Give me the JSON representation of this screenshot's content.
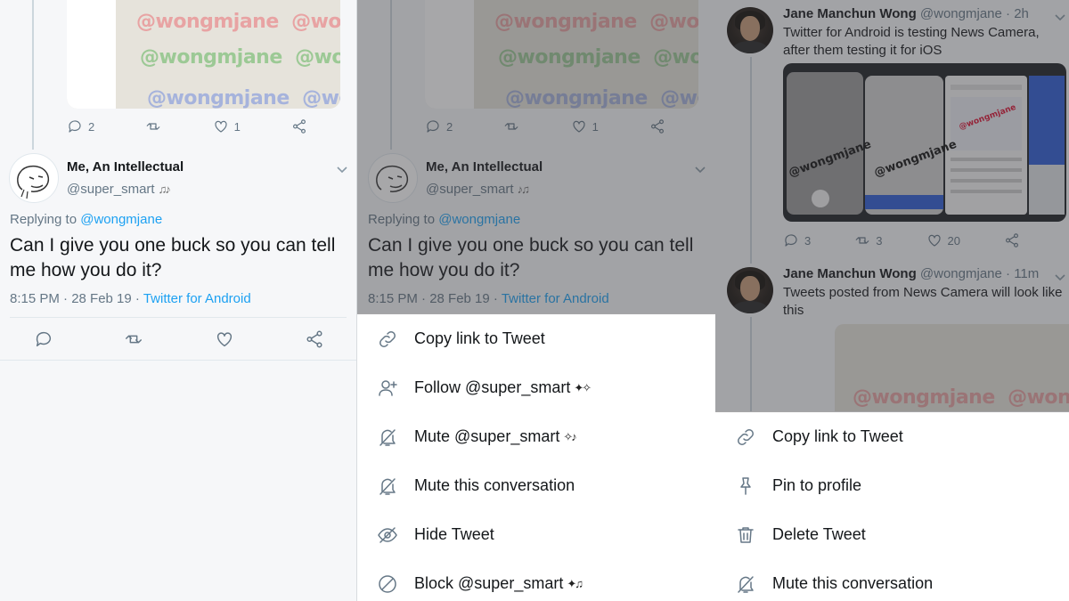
{
  "panel1": {
    "watermark": "@wongmjane",
    "parent_actions": {
      "reply_count": "2",
      "like_count": "1"
    },
    "reply": {
      "author_name": "Me, An Intellectual",
      "author_handle": "@super_smart",
      "replying_prefix": "Replying to",
      "replying_to": "@wongmjane",
      "text": "Can I give you one buck so you can tell me how you do it?",
      "timestamp": "8:15 PM · 28 Feb 19 ·",
      "source": "Twitter for Android"
    }
  },
  "panel2": {
    "watermark": "@wongmjane",
    "parent_actions": {
      "reply_count": "2",
      "like_count": "1"
    },
    "reply": {
      "author_name": "Me, An Intellectual",
      "author_handle": "@super_smart",
      "replying_prefix": "Replying to",
      "replying_to": "@wongmjane",
      "text": "Can I give you one buck so you can tell me how you do it?",
      "timestamp": "8:15 PM · 28 Feb 19 ·",
      "source": "Twitter for Android"
    },
    "menu": [
      {
        "label": "Copy link to Tweet",
        "icon": "link-icon"
      },
      {
        "label": "Follow @super_smart",
        "icon": "follow-icon"
      },
      {
        "label": "Mute @super_smart",
        "icon": "mute-icon"
      },
      {
        "label": "Mute this conversation",
        "icon": "mute-icon"
      },
      {
        "label": "Hide Tweet",
        "icon": "hide-icon"
      },
      {
        "label": "Block @super_smart",
        "icon": "block-icon"
      }
    ]
  },
  "panel3": {
    "tweet1": {
      "author_name": "Jane Manchun Wong",
      "author_handle": "@wongmjane",
      "time": "· 2h",
      "text": "Twitter for Android is testing News Camera, after them testing it for iOS",
      "reply_count": "3",
      "retweet_count": "3",
      "like_count": "20",
      "image_watermark": "@wongmjane"
    },
    "tweet2": {
      "author_name": "Jane Manchun Wong",
      "author_handle": "@wongmjane",
      "time": "· 11m",
      "text": "Tweets posted from News Camera will look like this",
      "image_watermark": "@wongmjane"
    },
    "menu": [
      {
        "label": "Copy link to Tweet",
        "icon": "link-icon"
      },
      {
        "label": "Pin to profile",
        "icon": "pin-icon"
      },
      {
        "label": "Delete Tweet",
        "icon": "trash-icon"
      },
      {
        "label": "Mute this conversation",
        "icon": "mute-icon"
      }
    ]
  },
  "colors": {
    "link": "#1da1f2",
    "text": "#14171a",
    "secondary": "#657786",
    "overlay": "rgba(60,60,64,0.45)"
  }
}
